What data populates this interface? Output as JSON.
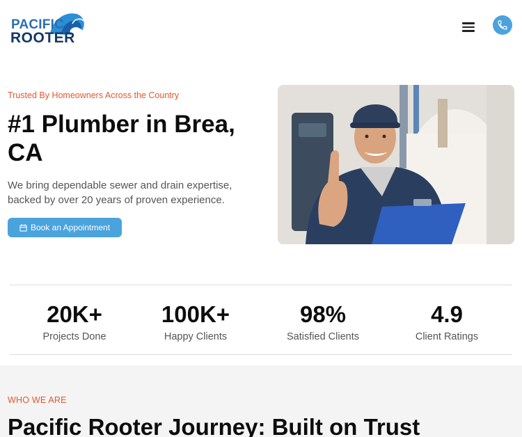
{
  "brand": {
    "logo_line1": "PACIFIC",
    "logo_line2": "ROOTER",
    "primary_color": "#4aa3dd",
    "navy_color": "#143866",
    "accent_color": "#e4572e"
  },
  "header": {
    "menu_icon": "hamburger-menu-icon",
    "phone_icon": "phone-icon"
  },
  "hero": {
    "eyebrow": "Trusted By Homeowners Across the Country",
    "title": "#1 Plumber in Brea, CA",
    "description": "We bring dependable sewer and drain expertise, backed by over 20 years of proven experience.",
    "cta_label": "Book an Appointment",
    "cta_icon": "calendar-icon",
    "image_alt": "Smiling plumber in cap giving thumbs up holding clipboard"
  },
  "stats": [
    {
      "value": "20K+",
      "label": "Projects Done"
    },
    {
      "value": "100K+",
      "label": "Happy Clients"
    },
    {
      "value": "98%",
      "label": "Satisfied Clients"
    },
    {
      "value": "4.9",
      "label": "Client Ratings"
    }
  ],
  "who": {
    "kicker": "WHO WE ARE",
    "title": "Pacific Rooter Journey: Built on Trust"
  }
}
